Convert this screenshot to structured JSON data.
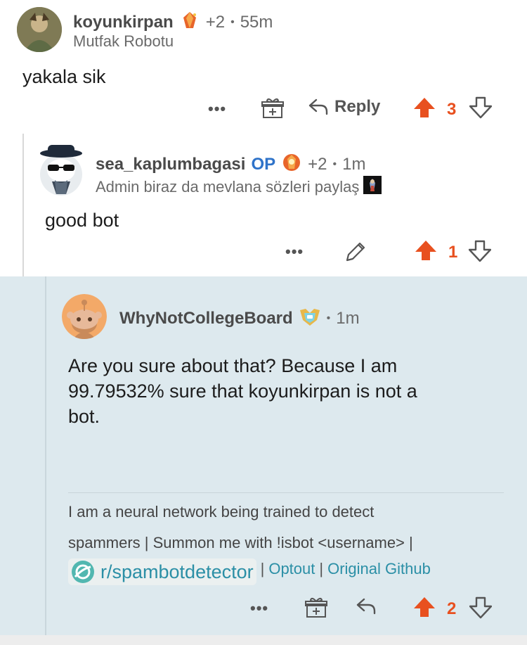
{
  "comment1": {
    "username": "koyunkirpan",
    "award_count": "+2",
    "separator": "•",
    "time": "55m",
    "flair": "Mutfak Robotu",
    "body": "yakala sik",
    "reply_label": "Reply",
    "vote_count": "3"
  },
  "comment2": {
    "username": "sea_kaplumbagasi",
    "op_badge": "OP",
    "award_count": "+2",
    "separator": "•",
    "time": "1m",
    "flair": "Admin biraz da mevlana sözleri paylaş",
    "body": "good bot",
    "vote_count": "1"
  },
  "comment3": {
    "username": "WhyNotCollegeBoard",
    "separator": "•",
    "time": "1m",
    "body_line1": "Are you sure about that? Because I am",
    "body_line2": "99.79532% sure that koyunkirpan is not a",
    "body_line3": "bot.",
    "footer_line1": "I am a neural network being trained to detect",
    "footer_line2": "spammers | Summon me with !isbot <username> |",
    "subreddit_link": "r/spambotdetector",
    "pipe1": "|",
    "optout": "Optout",
    "pipe2": "|",
    "github": "Original Github",
    "vote_count": "2"
  },
  "dots_label": "•••",
  "colors": {
    "upvote": "#e8501f",
    "highlight_bg": "#dde9ee",
    "op_blue": "#2f73c9",
    "link_teal": "#2b8fa6"
  }
}
